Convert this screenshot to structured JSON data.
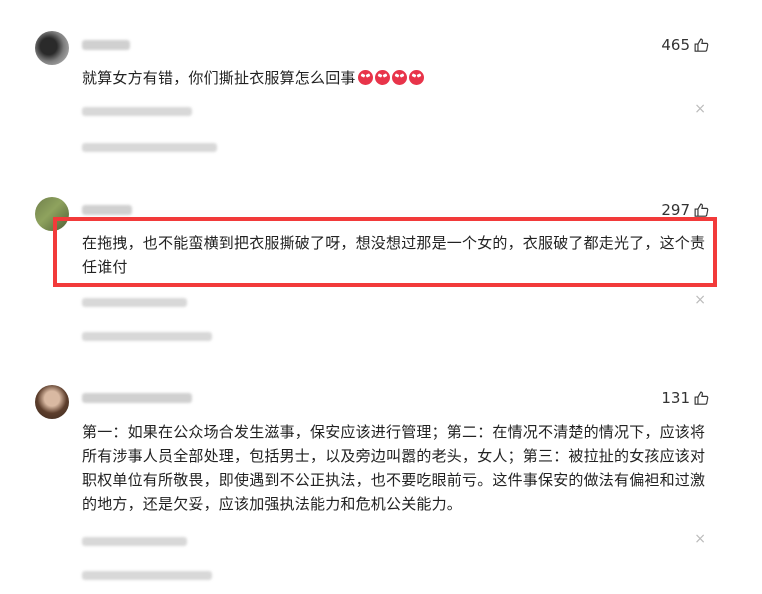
{
  "comments": [
    {
      "likes": "465",
      "text": "就算女方有错，你们撕扯衣服算怎么回事",
      "emoji_count": 4
    },
    {
      "likes": "297",
      "text": "在拖拽，也不能蛮横到把衣服撕破了呀，想没想过那是一个女的，衣服破了都走光了，这个责任谁付"
    },
    {
      "likes": "131",
      "text": "第一：如果在公众场合发生滋事，保安应该进行管理；第二：在情况不清楚的情况下，应该将所有涉事人员全部处理，包括男士，以及旁边叫嚣的老头，女人；第三：被拉扯的女孩应该对职权单位有所敬畏，即使遇到不公正执法，也不要吃眼前亏。这件事保安的做法有偏袒和过激的地方，还是欠妥，应该加强执法能力和危机公关能力。"
    }
  ],
  "close_symbol": "×",
  "icons": {
    "like": "thumbs-up-icon",
    "emoji": "angry-face-emoji-icon",
    "close": "close-icon"
  },
  "colors": {
    "highlight": "#f23a3a",
    "text": "#222222"
  }
}
